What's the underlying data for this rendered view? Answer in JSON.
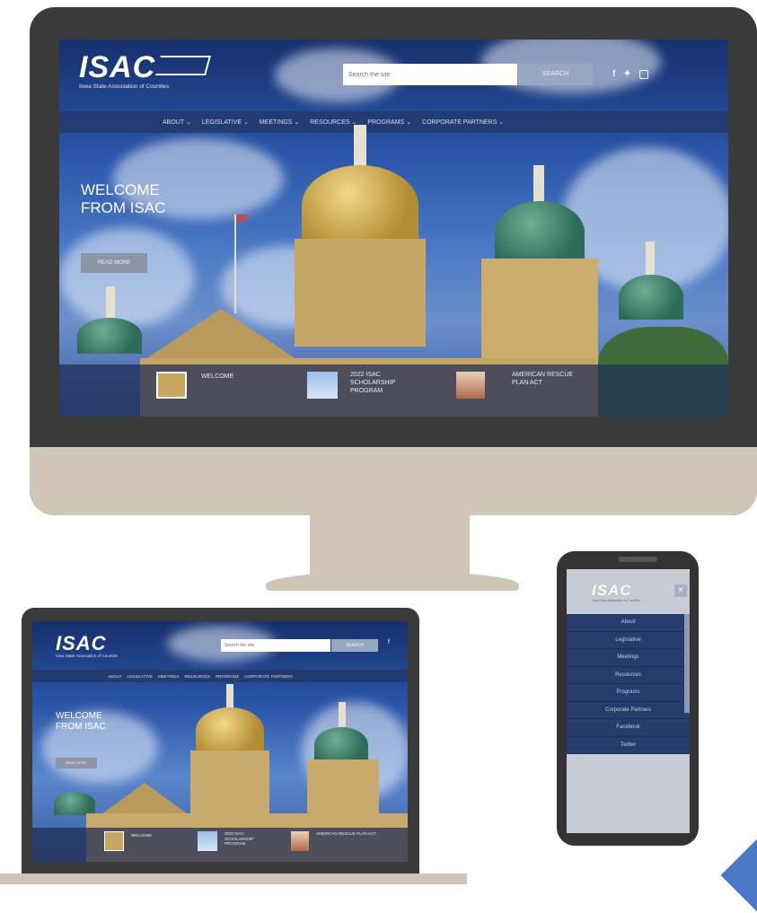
{
  "site": {
    "logo_text": "ISAC",
    "logo_subtitle": "Iowa State Association of Counties",
    "search_placeholder": "Search the site",
    "search_button": "SEARCH",
    "social_icons": [
      "facebook-icon",
      "twitter-icon",
      "instagram-icon"
    ],
    "nav": [
      {
        "label": "ABOUT"
      },
      {
        "label": "LEGISLATIVE"
      },
      {
        "label": "MEETINGS"
      },
      {
        "label": "RESOURCES"
      },
      {
        "label": "PROGRAMS"
      },
      {
        "label": "CORPORATE PARTNERS"
      }
    ],
    "hero_title_line1": "WELCOME",
    "hero_title_line2": "FROM ISAC",
    "hero_button": "READ MORE",
    "features": [
      {
        "label": "WELCOME"
      },
      {
        "label": "2022 ISAC SCHOLARSHIP PROGRAM"
      },
      {
        "label": "AMERICAN RESCUE PLAN ACT"
      }
    ]
  },
  "mobile_menu": {
    "close_label": "×",
    "items": [
      "About",
      "Legislative",
      "Meetings",
      "Resources",
      "Programs",
      "Corporate Partners",
      "Facebook",
      "Twitter"
    ]
  },
  "colors": {
    "device_frame": "#3a3a3a",
    "stand": "#cfc6b8",
    "nav_bar": "#233764",
    "accent_button": "#9aa7c0"
  }
}
